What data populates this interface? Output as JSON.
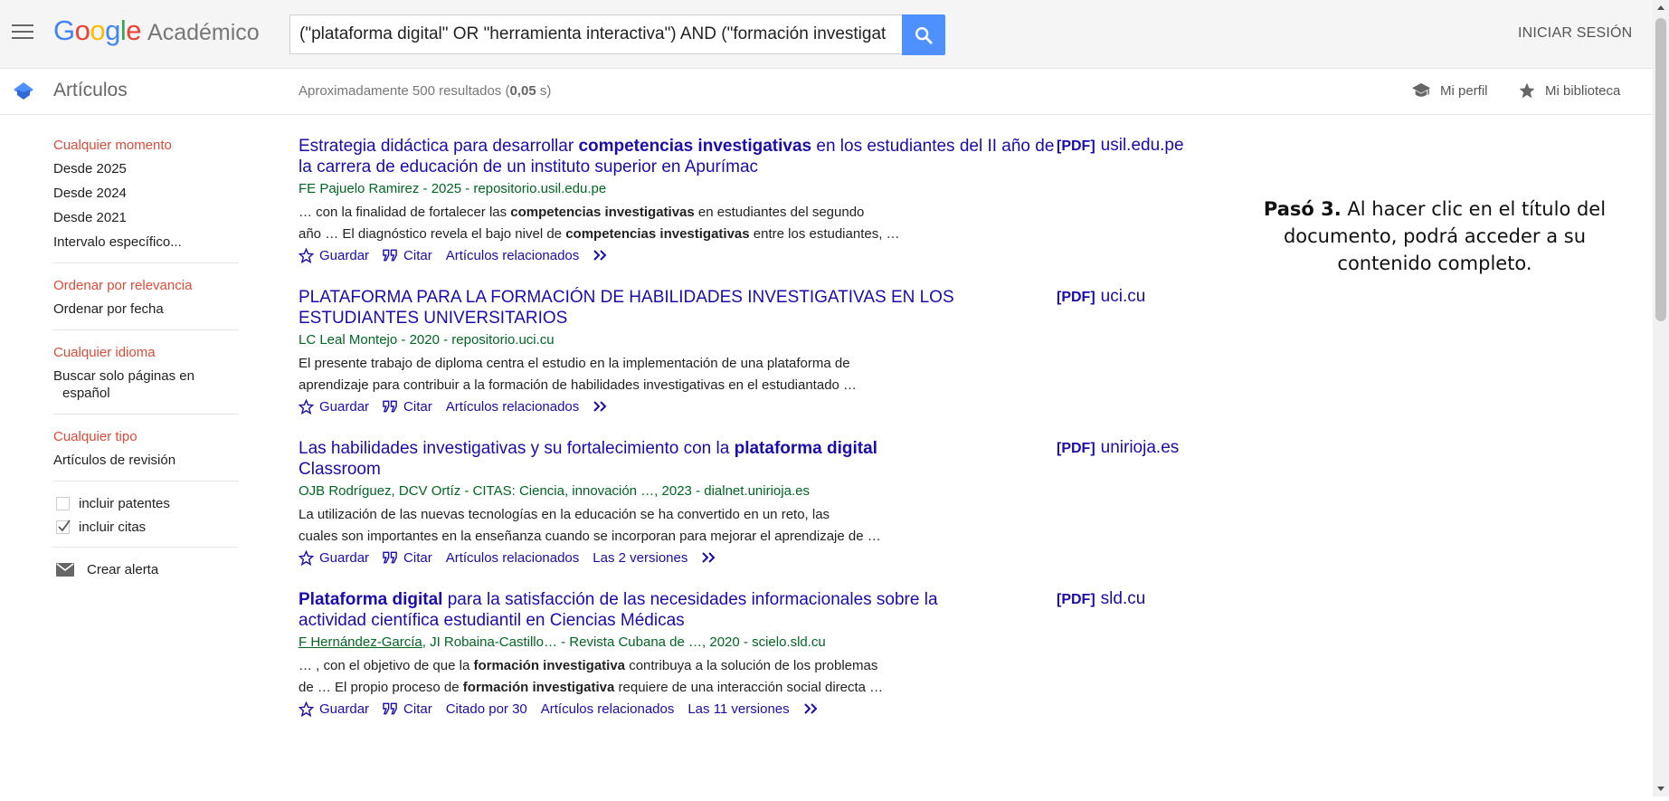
{
  "header": {
    "logo_google": "Google",
    "logo_product": "Académico",
    "search_query": "(\"plataforma digital\" OR \"herramienta interactiva\") AND (\"formación investigat",
    "signin_label": "INICIAR SESIÓN"
  },
  "subbar": {
    "section_title": "Artículos",
    "results_prefix": "Aproximadamente 500 resultados (",
    "results_time": "0,05",
    "results_suffix": " s)",
    "profile_label": "Mi perfil",
    "library_label": "Mi biblioteca"
  },
  "sidebar": {
    "time_header": "Cualquier momento",
    "time_items": [
      "Desde 2025",
      "Desde 2024",
      "Desde 2021",
      "Intervalo específico..."
    ],
    "sort_header": "Ordenar por relevancia",
    "sort_date": "Ordenar por fecha",
    "lang_header": "Cualquier idioma",
    "lang_item_line1": "Buscar solo páginas en",
    "lang_item_line2": "español",
    "type_header": "Cualquier tipo",
    "type_item": "Artículos de revisión",
    "include_patents": "incluir patentes",
    "include_citations": "incluir citas",
    "create_alert": "Crear alerta"
  },
  "results": [
    {
      "title_1": "Estrategia didáctica para desarrollar ",
      "title_2": "competencias investigativas",
      "title_3": " en los estudiantes del II año de la carrera de educación de un instituto superior en Apurímac",
      "meta": "FE Pajuelo Ramirez - 2025 - repositorio.usil.edu.pe",
      "snip_a1": "… con la finalidad de fortalecer las ",
      "snip_a2": "competencias investigativas",
      "snip_a3": " en estudiantes del segundo",
      "snip_b1": "año … El diagnóstico revela el bajo nivel de ",
      "snip_b2": "competencias investigativas",
      "snip_b3": " entre los estudiantes, …",
      "save": "Guardar",
      "cite": "Citar",
      "related": "Artículos relacionados",
      "pdf_tag": "[PDF]",
      "pdf_domain": "usil.edu.pe"
    },
    {
      "title": "PLATAFORMA PARA LA FORMACIÓN DE HABILIDADES INVESTIGATIVAS EN LOS ESTUDIANTES UNIVERSITARIOS",
      "meta": "LC Leal Montejo - 2020 - repositorio.uci.cu",
      "snip_a": "El presente trabajo de diploma centra el estudio en la implementación de una plataforma de",
      "snip_b": "aprendizaje para contribuir a la formación de habilidades investigativas en el estudiantado …",
      "save": "Guardar",
      "cite": "Citar",
      "related": "Artículos relacionados",
      "pdf_tag": "[PDF]",
      "pdf_domain": "uci.cu"
    },
    {
      "title_1": "Las habilidades investigativas y su fortalecimiento con la ",
      "title_2": "plataforma digital",
      "title_3": " Classroom",
      "meta": "OJB Rodríguez, DCV Ortíz - CITAS: Ciencia, innovación …, 2023 - dialnet.unirioja.es",
      "snip_a": "La utilización de las nuevas tecnologías en la educación se ha convertido en un reto, las",
      "snip_b": "cuales son importantes en la enseñanza cuando se incorporan para mejorar el aprendizaje de …",
      "save": "Guardar",
      "cite": "Citar",
      "related": "Artículos relacionados",
      "versions": "Las 2 versiones",
      "pdf_tag": "[PDF]",
      "pdf_domain": "unirioja.es"
    },
    {
      "title_1": "Plataforma digital",
      "title_2": " para la satisfacción de las necesidades informacionales sobre la actividad científica estudiantil en Ciencias Médicas",
      "meta_author": "F Hernández-García",
      "meta_rest": ", JI Robaina-Castillo… - Revista Cubana de …, 2020 - scielo.sld.cu",
      "snip_a1": "… , con el objetivo de que la ",
      "snip_a2": "formación investigativa",
      "snip_a3": " contribuya a la solución de los problemas",
      "snip_b1": "de … El propio proceso de ",
      "snip_b2": "formación investigativa",
      "snip_b3": " requiere de una interacción social directa …",
      "save": "Guardar",
      "cite": "Citar",
      "cited_by": "Citado por 30",
      "related": "Artículos relacionados",
      "versions": "Las 11 versiones",
      "pdf_tag": "[PDF]",
      "pdf_domain": "sld.cu"
    }
  ],
  "annotation": {
    "step": "Pasó 3.",
    "text": " Al hacer clic en el título del documento, podrá acceder a su contenido completo."
  },
  "colors": {
    "link_blue": "#1a0dab",
    "meta_green": "#006621",
    "filter_red": "#dd4b39",
    "search_button": "#4d90fe"
  }
}
